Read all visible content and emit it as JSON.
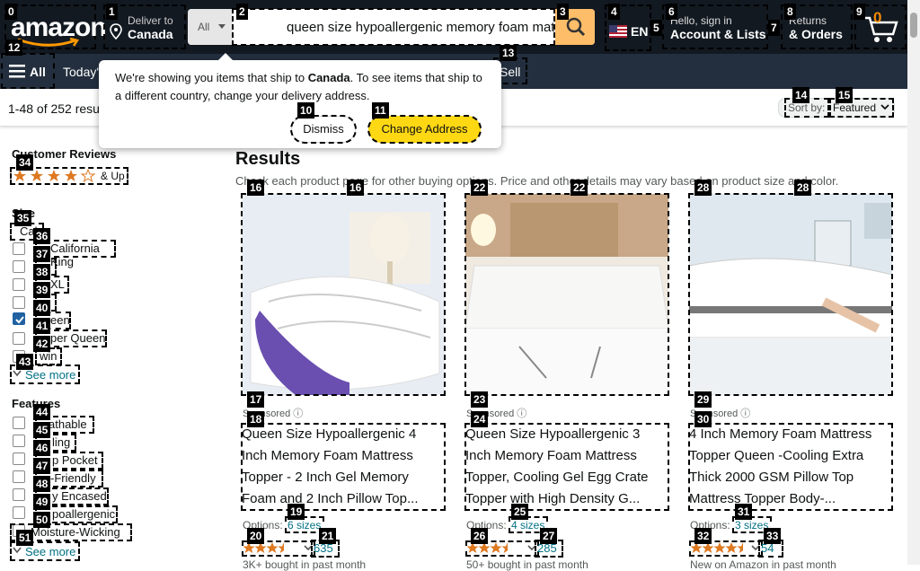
{
  "header": {
    "logo": "amazon",
    "deliver_to": "Deliver to",
    "deliver_country": "Canada",
    "search_category": "All",
    "search_value": "queen size hypoallergenic memory foam mattress",
    "lang": "EN",
    "hello": "Hello, sign in",
    "account_lists": "Account & Lists",
    "returns": "Returns",
    "orders": "& Orders",
    "cart_count": "0"
  },
  "subnav": {
    "all": "All",
    "today": "Today's",
    "sell": "Sell"
  },
  "popup": {
    "text1": "We're showing you items that ship to ",
    "text_country": "Canada",
    "text2": ". To see items that ship to a different country, change your delivery address.",
    "dismiss": "Dismiss",
    "change": "Change Address"
  },
  "results_bar": {
    "count": "1-48 of 252 resu",
    "sort_label": "Sort by:",
    "sort_value": "Featured"
  },
  "sidebar": {
    "reviews_title": "Customer Reviews",
    "and_up": "& Up",
    "size_title": "Size",
    "sizes": [
      "Cal",
      "California King",
      "Full",
      "Full XL",
      "King",
      "Queen",
      "Super Queen",
      "Twin"
    ],
    "see_more": "See more",
    "features_title": "Features",
    "features": [
      "Breathable",
      "Cooling",
      "Deep Pocket",
      "Eco-Friendly",
      "Fully Encased",
      "Hypoallergenic",
      "Moisture-Wicking"
    ],
    "see_more2": "See more"
  },
  "main": {
    "heading": "Results",
    "sub": "Check each product page for other buying options. Price and other details may vary based on product size and color.",
    "products": [
      {
        "sponsored": "Sponsored",
        "title": "Queen Size Hypoallergenic 4 Inch Memory Foam Mattress Topper - 2 Inch Gel Memory Foam and 2 Inch Pillow Top...",
        "options": "Options:",
        "sizes": "6 sizes",
        "rating_count": "635",
        "bought": "3K+ bought in past month",
        "stars": 3.5
      },
      {
        "sponsored": "Sponsored",
        "title": "Queen Size Hypoallergenic 3 Inch Memory Foam Mattress Topper, Cooling Gel Egg Crate Topper with High Density G...",
        "options": "Options:",
        "sizes": "4 sizes",
        "rating_count": "285",
        "bought": "50+ bought in past month",
        "stars": 3.5
      },
      {
        "sponsored": "Sponsored",
        "title": "4 Inch Memory Foam Mattress Topper Queen -Cooling Extra Thick 2000 GSM Pillow Top Mattress Topper Body-...",
        "options": "Options:",
        "sizes": "3 sizes",
        "rating_count": "54",
        "bought": "New on Amazon in past month",
        "stars": 4.0
      }
    ]
  },
  "marks": [
    "0",
    "1",
    "2",
    "3",
    "4",
    "5",
    "6",
    "7",
    "8",
    "9",
    "10",
    "11",
    "12",
    "13",
    "14",
    "15",
    "16",
    "16",
    "17",
    "18",
    "19",
    "20",
    "21",
    "22",
    "22",
    "23",
    "24",
    "25",
    "26",
    "27",
    "28",
    "28",
    "29",
    "30",
    "31",
    "32",
    "33",
    "34",
    "35",
    "36",
    "37",
    "38",
    "39",
    "40",
    "41",
    "42",
    "43",
    "44",
    "45",
    "46",
    "47",
    "48",
    "49",
    "50",
    "51"
  ],
  "colors": {
    "nav": "#131921",
    "subnav": "#232f3e",
    "accent": "#febd69",
    "yellow": "#ffd814",
    "star": "#de7921"
  }
}
